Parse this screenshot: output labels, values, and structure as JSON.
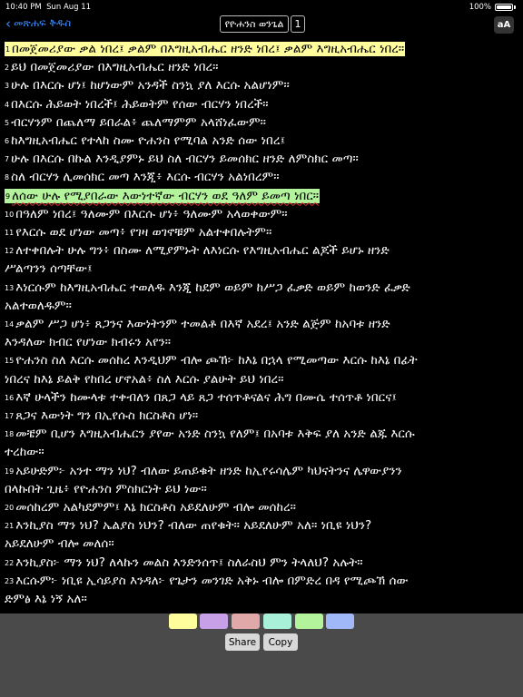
{
  "status_bar": {
    "time": "10:40 PM",
    "date": "Sun Aug 11",
    "battery": "100%"
  },
  "nav": {
    "back_label": "መጽሐፍ ቅዱስ",
    "book_title": "የዮሐንስ ወንጌል",
    "chapter": "1",
    "font_button": "aA"
  },
  "highlight_colors": {
    "yellow": "#fffd9c",
    "purple": "#c8a0e8",
    "pink": "#e0a8a8",
    "mint": "#a8f0d8",
    "green": "#b2f39b",
    "blue": "#a0b8f8"
  },
  "verses": [
    {
      "num": "1",
      "text": "በመጀመሪያው ቃል ነበረ፤ ቃልም በእግዚአብሔር ዘንድ ነበረ፤ ቃልም እግዚአብሔር ነበረ።",
      "highlight": "yellow"
    },
    {
      "num": "2",
      "text": "ይህ በመጀመሪያው በእግዚአብሔር ዘንድ ነበረ።"
    },
    {
      "num": "3",
      "text": "ሁሉ በእርሱ ሆነ፤ ከሆነውም አንዳች ስንኳ ያለ እርሱ አልሆነም።"
    },
    {
      "num": "4",
      "text": "በእርሱ ሕይወት ነበረች፤ ሕይወትም የሰው ብርሃን ነበረች።"
    },
    {
      "num": "5",
      "text": "ብርሃንም በጨለማ ይበራል፥ ጨለማምም አላሸነፈውም።"
    },
    {
      "num": "6",
      "text": "ከእግዚአብሔር የተላከ ስሙ ዮሐንስ የሚባል አንድ ሰው ነበረ፤"
    },
    {
      "num": "7",
      "text": "ሁሉ በእርሱ በኩል እንዲያምኑ ይህ ስለ ብርሃን ይመሰክር ዘንድ ለምስክር መጣ።"
    },
    {
      "num": "8",
      "text": "ስለ ብርሃን ሊመሰክር መጣ እንጂ፥ እርሱ ብርሃን አልነበረም።"
    },
    {
      "num": "9",
      "text": "ለሰው ሁሉ የሚያበራው እውነተኛው ብርሃን ወደ ዓለም ይመጣ ነበር።",
      "highlight": "green",
      "squiggle": true
    },
    {
      "num": "10",
      "text": "በዓለም ነበረ፤ ዓለሙም በእርሱ ሆነ፥ ዓለሙም አላወቀውም።"
    },
    {
      "num": "11",
      "text": "የእርሱ ወደ ሆነው መጣ፥ የገዛ ወገኖቹም አልተቀበሉትም።"
    },
    {
      "num": "12",
      "text": "ለተቀበሉት ሁሉ ግን፥ በስሙ ለሚያምኑት ለእነርሱ የእግዚአብሔር ልጆች ይሆኑ ዘንድ",
      "cont": "ሥልጣንን ሰጣቸው፤"
    },
    {
      "num": "13",
      "text": "እነርሱም ከእግዚአብሔር ተወለዱ እንጂ ከደም ወይም ከሥጋ ፈቃድ ወይም ከወንድ ፈቃድ",
      "cont": "አልተወለዱም።"
    },
    {
      "num": "14",
      "text": "ቃልም ሥጋ ሆነ፥ ጸጋንና እውነትንም ተመልቶ በእኛ አደረ፤ አንድ ልጅም ከአባቱ ዘንድ",
      "cont": "እንዳለው ክብር የሆነው ክብሩን አየን።"
    },
    {
      "num": "15",
      "text": "ዮሐንስ ስለ እርሱ መሰከረ እንዲህም ብሎ ጮኸ፦ ከእኔ በኋላ የሚመጣው እርሱ ከእኔ በፊት",
      "cont": "ነበረና ከእኔ ይልቅ የከበረ ሆኖአል፥ ስለ እርሱ ያልሁት ይህ ነበረ።"
    },
    {
      "num": "16",
      "text": "እኛ ሁላችን ከሙላቱ ተቀብለን በጸጋ ላይ ጸጋ ተሰጥቶናልና ሕግ በሙሴ ተሰጥቶ ነበርና፤"
    },
    {
      "num": "17",
      "text": "ጸጋና እውነት ግን በኢየሱስ ክርስቶስ ሆነ።"
    },
    {
      "num": "18",
      "text": "መቼም ቢሆን እግዚአብሔርን ያየው አንድ ስንኳ የለም፤ በአባቱ እቅፍ ያለ አንድ ልጁ እርሱ",
      "cont": "ተረከው።"
    },
    {
      "num": "19",
      "text": "አይሁድም፦ አንተ ማን ነህ? ብለው ይጠይቁት ዘንድ ከኢየሩሳሌም ካህናትንና ሌዋውያንን",
      "cont": "በላኩበት ጊዜ፥ የዮሐንስ ምስክርነት ይህ ነው።"
    },
    {
      "num": "20",
      "text": "መሰከረም አልካደምም፤ እኔ ክርስቶስ አይደለሁም ብሎ መሰከረ።"
    },
    {
      "num": "21",
      "text": "እንኪያስ ማን ነህ? ኤልያስ ነህን? ብለው ጠየቁት። አይደለሁም አለ። ነቢዩ ነህን?",
      "cont": "አይደለሁም ብሎ መለሰ።"
    },
    {
      "num": "22",
      "text": "እንኪያስ፦ ማን ነህ? ለላኩን መልስ እንድንሰጥ፤ ስለራስህ ምን ትላለህ? አሉት።"
    },
    {
      "num": "23",
      "text": "እርሱም፦ ነቢዩ ኢሳይያስ እንዳለ፦ የጌታን መንገድ አቅኑ ብሎ በምድረ በዳ የሚጮኽ ሰው",
      "cont": "ድምፅ እኔ ነኝ አለ።"
    }
  ],
  "actions": {
    "share": "Share",
    "copy": "Copy"
  }
}
